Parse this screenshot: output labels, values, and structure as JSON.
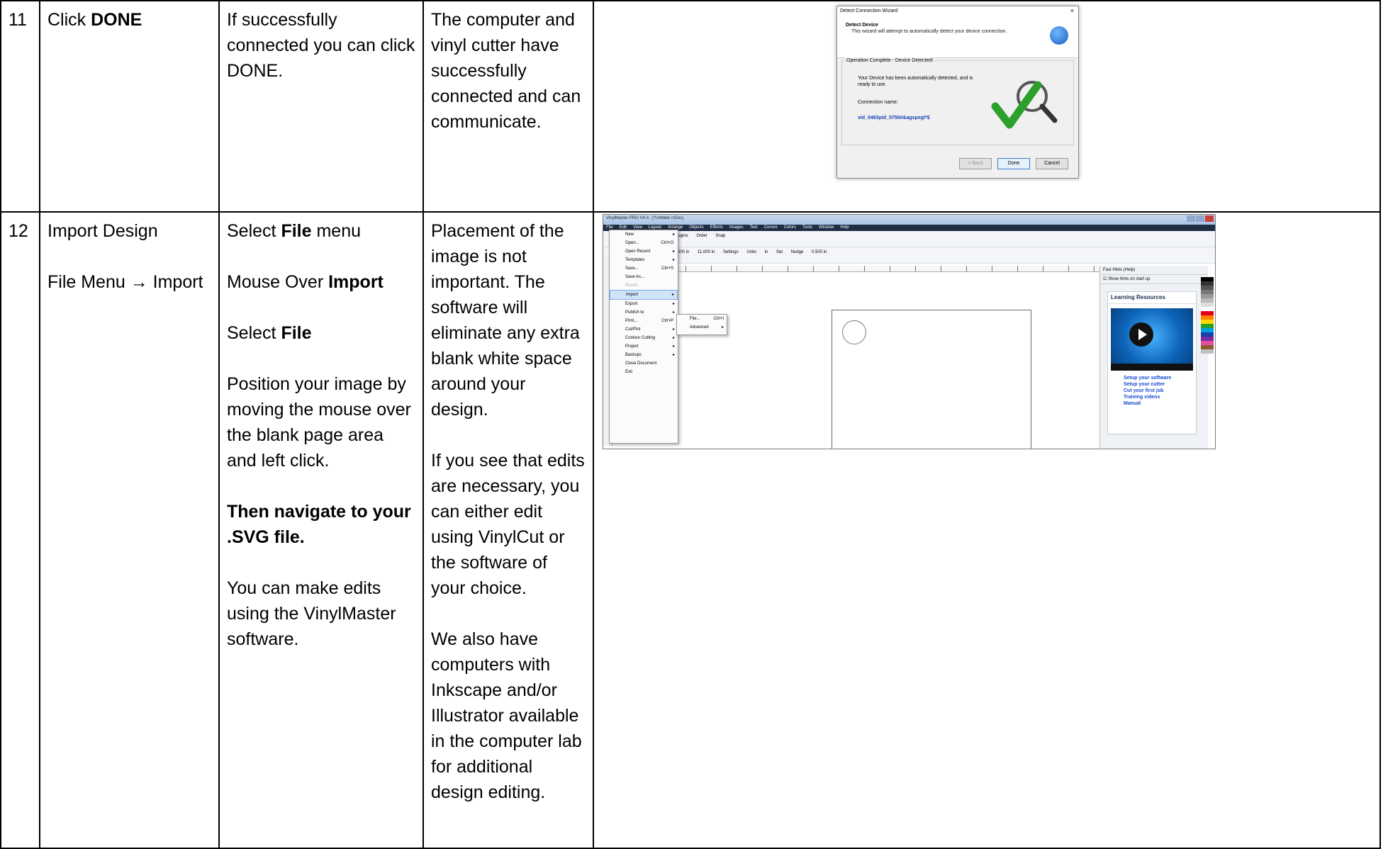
{
  "rows": [
    {
      "num": "11",
      "step_title": "Click",
      "step_title_bold": "DONE",
      "instructions": "If successfully connected you can click DONE.",
      "notes": "The computer and vinyl cutter have successfully connected and can communicate."
    },
    {
      "num": "12",
      "step_title": "Import Design",
      "step_path": "File Menu → Import",
      "instr_1_pre": "Select ",
      "instr_1_bold": "File",
      "instr_1_post": " menu",
      "instr_2_pre": "Mouse Over ",
      "instr_2_bold": "Import",
      "instr_3_pre": "Select ",
      "instr_3_bold": "File",
      "instr_4": "Position your image by moving the mouse over the blank page area and left click.",
      "instr_5_bold": "Then navigate to your .SVG file.",
      "instr_6": "You can make edits using the VinylMaster software.",
      "notes_1": "Placement of the image is not important. The software will eliminate any extra blank white space around your design.",
      "notes_2": "If you see that edits are necessary, you can either edit using VinylCut or the software of your choice.",
      "notes_3": "We also have computers with Inkscape and/or Illustrator available in the computer lab for additional design editing."
    }
  ],
  "wizard": {
    "title": "Detect Connection Wizard",
    "close": "×",
    "header_title": "Detect Device",
    "header_sub": "This wizard will attempt to automatically detect your device connection.",
    "group_label": "Operation Complete - Device Detected!",
    "message": "Your Device has been automatically detected, and is ready to use.",
    "conn_label": "Connection name:",
    "conn_value": "vid_0483pid_5750#&agspegl*$",
    "back": "< Back",
    "done": "Done",
    "cancel": "Cancel"
  },
  "vinylmaster": {
    "title": "VinylMaster PRO V4.3 - [*Untitled </Doc]",
    "menubar": [
      "File",
      "Edit",
      "View",
      "Layout",
      "Arrange",
      "Objects",
      "Effects",
      "Images",
      "Text",
      "Curves",
      "Colors",
      "Tools",
      "Window",
      "Help"
    ],
    "toolbar": [
      "Plugins",
      "Order",
      "Snap"
    ],
    "toolbar2": [
      "0.500 in",
      "11.000 in",
      "Settings",
      "Units",
      "in",
      "Set",
      "Nudge",
      "0.500 in"
    ],
    "file_menu": [
      {
        "label": "New",
        "shortcut": "",
        "arrow": "▸"
      },
      {
        "label": "Open...",
        "shortcut": "Ctrl+O",
        "arrow": ""
      },
      {
        "label": "Open Recent",
        "shortcut": "",
        "arrow": "▸"
      },
      {
        "label": "Templates",
        "shortcut": "",
        "arrow": "▸"
      },
      {
        "label": "Save...",
        "shortcut": "Ctrl+S",
        "arrow": ""
      },
      {
        "label": "Save As...",
        "shortcut": "",
        "arrow": ""
      },
      {
        "label": "Revert",
        "shortcut": "",
        "arrow": ""
      },
      {
        "label": "Import",
        "shortcut": "",
        "arrow": "▸"
      },
      {
        "label": "Export",
        "shortcut": "",
        "arrow": "▸"
      },
      {
        "label": "Publish to",
        "shortcut": "",
        "arrow": "▸"
      },
      {
        "label": "Print...",
        "shortcut": "Ctrl+P",
        "arrow": ""
      },
      {
        "label": "Cut/Plot",
        "shortcut": "",
        "arrow": "▸"
      },
      {
        "label": "Contour Cutting",
        "shortcut": "",
        "arrow": "▸"
      },
      {
        "label": "Project",
        "shortcut": "",
        "arrow": "▸"
      },
      {
        "label": "Backups",
        "shortcut": "",
        "arrow": "▸"
      },
      {
        "label": "Close Document",
        "shortcut": "",
        "arrow": ""
      },
      {
        "label": "Exit",
        "shortcut": "",
        "arrow": ""
      }
    ],
    "import_submenu": [
      {
        "label": "File...",
        "shortcut": "Ctrl+I"
      },
      {
        "label": "Advanced",
        "shortcut": "▸"
      }
    ],
    "hints_title": "Fast Hints (Help)",
    "hints_checkbox": "Show hints on start up",
    "learning_title": "Learning Resources",
    "links": [
      "Setup your software",
      "Setup your cutter",
      "Cut your first job",
      "Training videos",
      "Manual"
    ],
    "palette": [
      "#000000",
      "#333333",
      "#555555",
      "#777777",
      "#999999",
      "#bbbbbb",
      "#dddddd",
      "#ffffff",
      "#e2001a",
      "#ff7f00",
      "#ffd700",
      "#2a9d2a",
      "#00a0e0",
      "#1d3fa8",
      "#7a2a9a",
      "#e24fa0",
      "#8b5a2b",
      "#c0c0c0"
    ]
  }
}
